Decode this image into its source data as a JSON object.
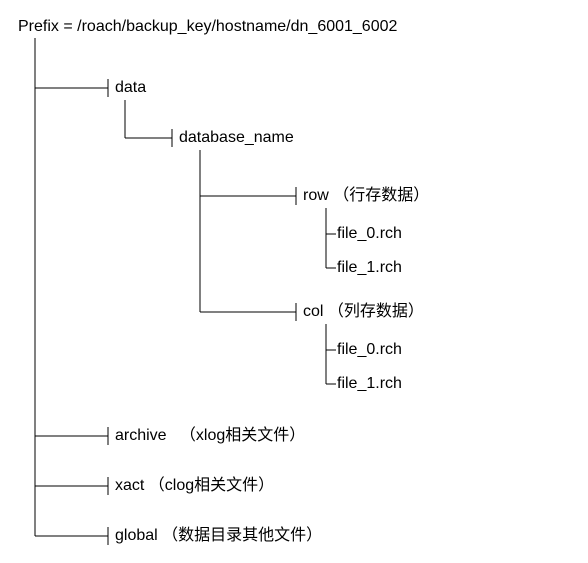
{
  "prefix": {
    "label": "Prefix",
    "equals": "=",
    "path": "/roach/backup_key/hostname/dn_6001_6002"
  },
  "tree": {
    "data": {
      "label": "data",
      "database_name": {
        "label": "database_name",
        "row": {
          "label": "row",
          "note": "（行存数据）",
          "files": [
            "file_0.rch",
            "file_1.rch"
          ]
        },
        "col": {
          "label": "col",
          "note": "（列存数据）",
          "files": [
            "file_0.rch",
            "file_1.rch"
          ]
        }
      }
    },
    "archive": {
      "label": "archive",
      "note": "（xlog相关文件）"
    },
    "xact": {
      "label": "xact",
      "note": "（clog相关文件）"
    },
    "global": {
      "label": "global",
      "note": "（数据目录其他文件）"
    }
  }
}
